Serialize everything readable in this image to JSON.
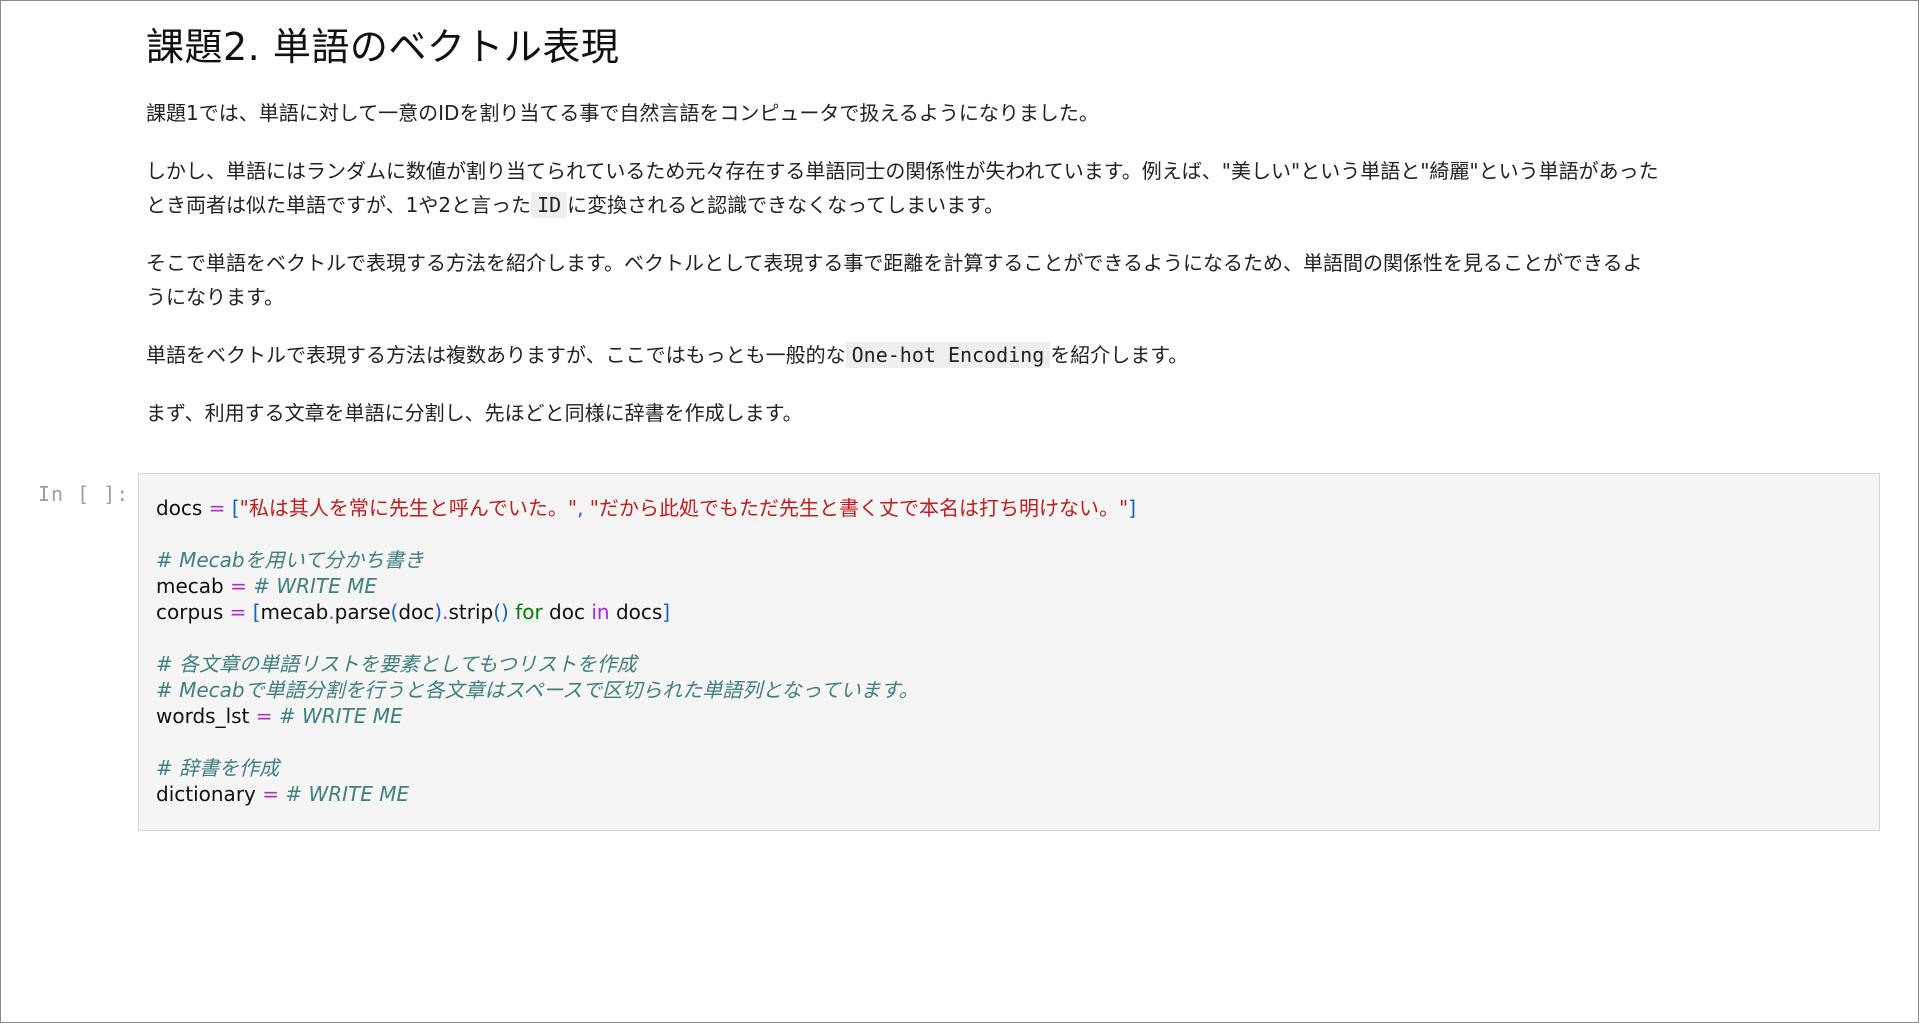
{
  "markdown": {
    "title": "課題2. 単語のベクトル表現",
    "p1": "課題1では、単語に対して一意のIDを割り当てる事で自然言語をコンピュータで扱えるようになりました。",
    "p2_line1": "しかし、単語にはランダムに数値が割り当てられているため元々存在する単語同士の関係性が失われています。例えば、\"美しい\"という単語と\"綺麗\"という単語があった",
    "p2_line2_pre": "とき両者は似た単語ですが、1や2と言った",
    "p2_code": "ID",
    "p2_line2_post": "に変換されると認識できなくなってしまいます。",
    "p3_line1": "そこで単語をベクトルで表現する方法を紹介します。ベクトルとして表現する事で距離を計算することができるようになるため、単語間の関係性を見ることができるよ",
    "p3_line2": "うになります。",
    "p4_pre": "単語をベクトルで表現する方法は複数ありますが、ここではもっとも一般的な",
    "p4_code": "One-hot Encoding",
    "p4_post": "を紹介します。",
    "p5": "まず、利用する文章を単語に分割し、先ほどと同様に辞書を作成します。"
  },
  "cell": {
    "prompt": "In [ ]:",
    "l1_var": "docs",
    "eq": "=",
    "l1_open": "[",
    "l1_str1": "\"私は其人を常に先生と呼んでいた。\"",
    "l1_comma": ",",
    "l1_str2": "\"だから此処でもただ先生と書く丈で本名は打ち明けない。\"",
    "l1_close": "]",
    "c1": "# Mecabを用いて分かち書き",
    "l2_var": "mecab",
    "write_me": "# WRITE ME",
    "l3_var": "corpus",
    "l3_open": "[",
    "l3_obj": "mecab",
    "dot": ".",
    "l3_parse": "parse",
    "l3_po": "(",
    "l3_doc": "doc",
    "l3_pc": ")",
    "l3_strip": "strip",
    "l3_parens": "()",
    "kw_for": "for",
    "l3_doc2": "doc",
    "kw_in": "in",
    "l3_docs": "docs",
    "l3_close": "]",
    "c2": "# 各文章の単語リストを要素としてもつリストを作成",
    "c3": "# Mecabで単語分割を行うと各文章はスペースで区切られた単語列となっています。",
    "l4_var": "words_lst",
    "c4": "# 辞書を作成",
    "l5_var": "dictionary"
  },
  "colors": {
    "operator": "#b12ec9",
    "bracket": "#1565c0",
    "string": "#c21c1c",
    "comment": "#3f7f7f",
    "keyword": "#008000"
  }
}
